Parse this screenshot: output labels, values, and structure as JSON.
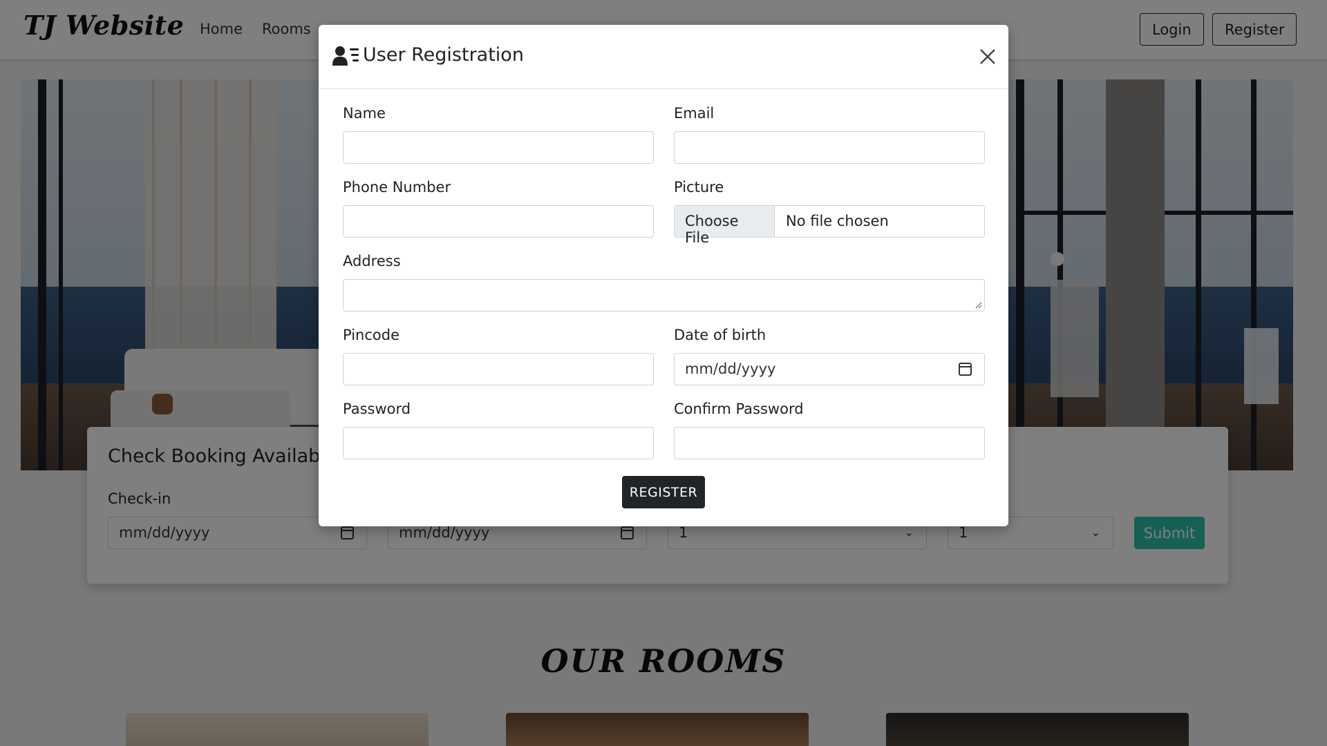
{
  "navbar": {
    "brand": "TJ Website",
    "links": [
      "Home",
      "Rooms"
    ],
    "login_label": "Login",
    "register_label": "Register"
  },
  "booking": {
    "title": "Check Booking Availabil",
    "checkin_label": "Check-in",
    "checkin_value": "mm/dd/yyyy",
    "checkout_value": "mm/dd/yyyy",
    "adults_value": "1",
    "children_value": "1",
    "submit_label": "Submit"
  },
  "rooms": {
    "title": "OUR ROOMS"
  },
  "modal": {
    "title": "User Registration",
    "fields": {
      "name": "Name",
      "email": "Email",
      "phone": "Phone Number",
      "picture": "Picture",
      "address": "Address",
      "pincode": "Pincode",
      "dob": "Date of birth",
      "password": "Password",
      "confirm_password": "Confirm Password"
    },
    "file_button": "Choose File",
    "file_status": "No file chosen",
    "dob_placeholder": "mm/dd/yyyy",
    "register_button": "REGISTER"
  },
  "colors": {
    "accent": "#2ec1ac",
    "dark_button": "#212529",
    "backdrop": "rgba(0,0,0,0.5)"
  }
}
